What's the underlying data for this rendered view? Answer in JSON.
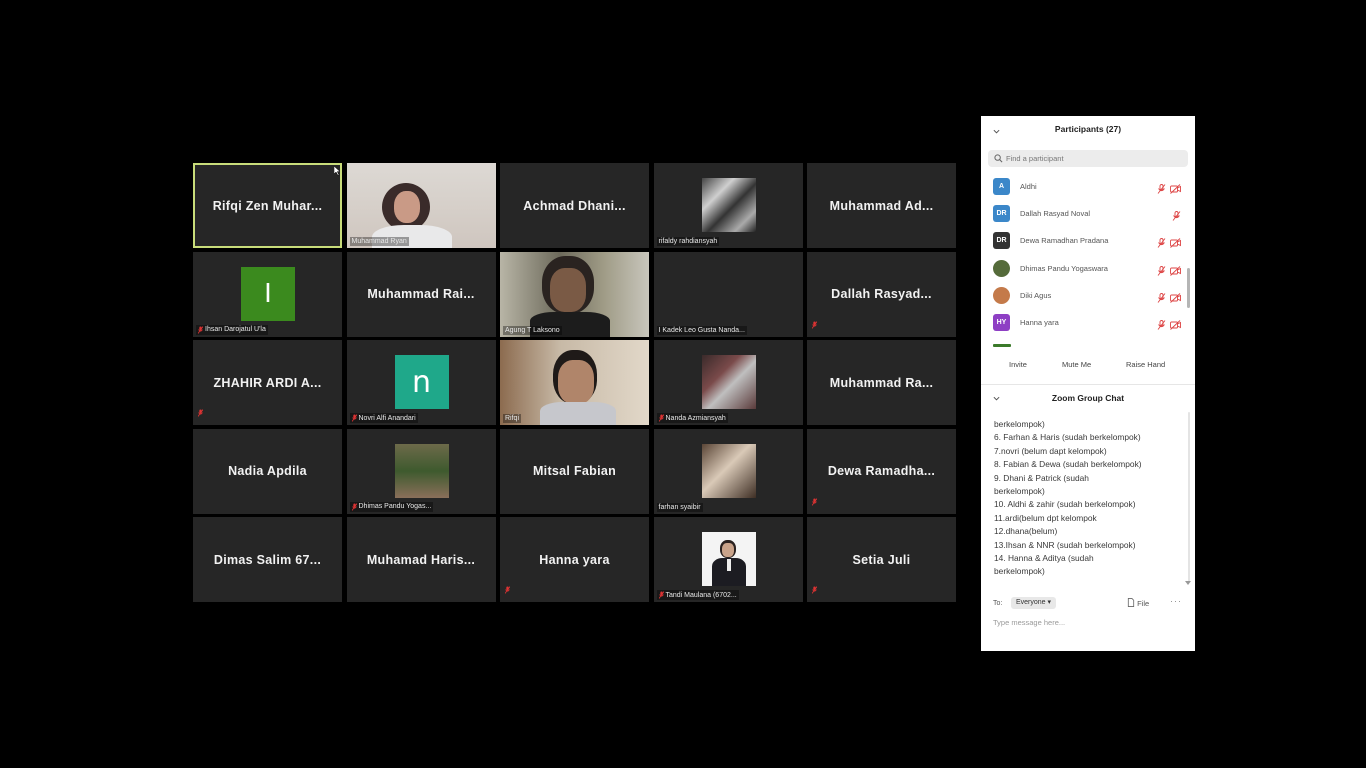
{
  "meeting": {
    "tiles": [
      {
        "name": "Rifqi Zen Muhar...",
        "label": "",
        "muted": false,
        "active": true,
        "type": "name"
      },
      {
        "name": "",
        "label": "Muhammad Ryan",
        "muted": false,
        "type": "video"
      },
      {
        "name": "Achmad Dhani...",
        "label": "",
        "muted": false,
        "type": "name"
      },
      {
        "name": "",
        "label": "rifaldy rahdiansyah",
        "muted": false,
        "type": "photo"
      },
      {
        "name": "Muhammad Ad...",
        "label": "",
        "muted": false,
        "type": "name"
      },
      {
        "name": "",
        "label": "Ihsan Darojatul U'la",
        "muted": true,
        "type": "avatar",
        "avatar_letter": "I",
        "avatar_color": "#3b8a1e"
      },
      {
        "name": "Muhammad Rai...",
        "label": "",
        "muted": false,
        "type": "name"
      },
      {
        "name": "",
        "label": "Agung T Laksono",
        "muted": false,
        "type": "video"
      },
      {
        "name": "",
        "label": "I Kadek Leo Gusta Nanda...",
        "muted": false,
        "type": "blank"
      },
      {
        "name": "Dallah Rasyad...",
        "label": "",
        "muted": true,
        "type": "name"
      },
      {
        "name": "ZHAHIR ARDI A...",
        "label": "",
        "muted": true,
        "type": "name"
      },
      {
        "name": "",
        "label": "Novri Alfi Anandari",
        "muted": true,
        "type": "avatar",
        "avatar_letter": "n",
        "avatar_color": "#1fa88a"
      },
      {
        "name": "",
        "label": "Rifqi",
        "muted": false,
        "type": "video"
      },
      {
        "name": "",
        "label": "Nanda Azmiansyah",
        "muted": true,
        "type": "photo"
      },
      {
        "name": "Muhammad Ra...",
        "label": "",
        "muted": false,
        "type": "name"
      },
      {
        "name": "Nadia Apdila",
        "label": "",
        "muted": false,
        "type": "name"
      },
      {
        "name": "",
        "label": "Dhimas Pandu Yogas...",
        "muted": true,
        "type": "photo"
      },
      {
        "name": "Mitsal Fabian",
        "label": "",
        "muted": false,
        "type": "name"
      },
      {
        "name": "",
        "label": "farhan syaibir",
        "muted": false,
        "type": "photo"
      },
      {
        "name": "Dewa Ramadha...",
        "label": "",
        "muted": true,
        "type": "name"
      },
      {
        "name": "Dimas Salim 67...",
        "label": "",
        "muted": false,
        "type": "name"
      },
      {
        "name": "Muhamad Haris...",
        "label": "",
        "muted": false,
        "type": "name"
      },
      {
        "name": "Hanna yara",
        "label": "",
        "muted": true,
        "type": "name"
      },
      {
        "name": "",
        "label": "Tandi Maulana (6702...",
        "muted": true,
        "type": "photo"
      },
      {
        "name": "Setia Juli",
        "label": "",
        "muted": true,
        "type": "name"
      }
    ]
  },
  "panel": {
    "participants_title": "Participants (27)",
    "search_placeholder": "Find a participant",
    "participants": [
      {
        "initials": "A",
        "name": "Aldhi",
        "color": "#3b87c9",
        "video_off": true
      },
      {
        "initials": "DR",
        "name": "Dallah Rasyad Noval",
        "color": "#3b87c9",
        "video_off": false
      },
      {
        "initials": "DR",
        "name": "Dewa Ramadhan Pradana",
        "color": "#333333",
        "video_off": true
      },
      {
        "initials": "",
        "name": "Dhimas Pandu Yogaswara",
        "color": "#556b3a",
        "video_off": true
      },
      {
        "initials": "",
        "name": "Diki Agus",
        "color": "#c47a4a",
        "video_off": true
      },
      {
        "initials": "HY",
        "name": "Hanna yara",
        "color": "#8e3fc4",
        "video_off": true
      }
    ],
    "buttons": {
      "invite": "Invite",
      "mute_me": "Mute Me",
      "raise_hand": "Raise Hand"
    },
    "chat_title": "Zoom Group Chat",
    "chat_lines": [
      "berkelompok)",
      "6. Farhan & Haris (sudah berkelompok)",
      "7.novri (belum dapt kelompok)",
      "8. Fabian & Dewa (sudah berkelompok)",
      "9. Dhani & Patrick (sudah",
      "berkelompok)",
      "10. Aldhi & zahir (sudah berkelompok)",
      "11.ardi(belum dpt kelompok",
      "12.dhana(belum)",
      "13.Ihsan & NNR (sudah berkelompok)",
      "14. Hanna & Aditya (sudah",
      "berkelompok)"
    ],
    "to_label": "To:",
    "to_value": "Everyone",
    "file_label": "File",
    "more_label": "···",
    "message_placeholder": "Type message here..."
  }
}
